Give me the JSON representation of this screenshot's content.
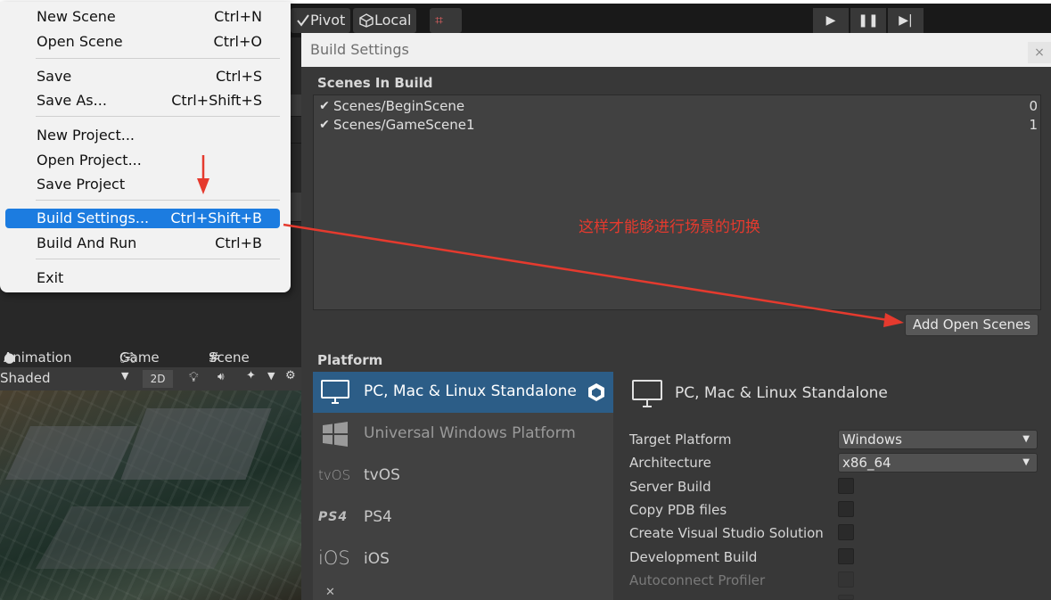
{
  "toolbar": {
    "pivot_label": "Pivot",
    "local_label": "Local",
    "play_icons": [
      "play-icon",
      "pause-icon",
      "step-icon"
    ]
  },
  "menu": {
    "items": [
      {
        "label": "New Scene",
        "shortcut": "Ctrl+N"
      },
      {
        "label": "Open Scene",
        "shortcut": "Ctrl+O"
      },
      {
        "label": "Save",
        "shortcut": "Ctrl+S"
      },
      {
        "label": "Save As...",
        "shortcut": "Ctrl+Shift+S"
      },
      {
        "label": "New Project...",
        "shortcut": ""
      },
      {
        "label": "Open Project...",
        "shortcut": ""
      },
      {
        "label": "Save Project",
        "shortcut": ""
      },
      {
        "label": "Build Settings...",
        "shortcut": "Ctrl+Shift+B"
      },
      {
        "label": "Build And Run",
        "shortcut": "Ctrl+B"
      },
      {
        "label": "Exit",
        "shortcut": ""
      }
    ],
    "active_item": "Build Settings..."
  },
  "panel_tabs": {
    "animation": "Animation",
    "game": "Game",
    "scene": "Scene",
    "shading_mode": "Shaded",
    "mode_2d": "2D"
  },
  "build_settings": {
    "title": "Build Settings",
    "close_label": "×",
    "scenes_header": "Scenes In Build",
    "scenes": [
      {
        "name": "Scenes/BeginScene",
        "index": "0",
        "checked": true
      },
      {
        "name": "Scenes/GameScene1",
        "index": "1",
        "checked": true
      }
    ],
    "check_mark": "✔",
    "add_open_scenes": "Add Open Scenes",
    "platform_header": "Platform",
    "platforms": [
      {
        "label": "PC, Mac & Linux Standalone",
        "icon": "monitor-icon"
      },
      {
        "label": "Universal Windows Platform",
        "icon": "windows-icon"
      },
      {
        "label": "tvOS",
        "icon": "tvos-icon",
        "icon_text": "tvOS"
      },
      {
        "label": "PS4",
        "icon": "ps4-icon",
        "icon_text": "PS4"
      },
      {
        "label": "iOS",
        "icon": "ios-icon",
        "icon_text": "iOS"
      }
    ],
    "selected_platform": "PC, Mac & Linux Standalone",
    "detail_title": "PC, Mac & Linux Standalone",
    "options": {
      "target_platform": {
        "label": "Target Platform",
        "value": "Windows"
      },
      "architecture": {
        "label": "Architecture",
        "value": "x86_64"
      },
      "server_build": "Server Build",
      "copy_pdb": "Copy PDB files",
      "create_vs": "Create Visual Studio Solution",
      "development_build": "Development Build",
      "autoconnect_profiler": "Autoconnect Profiler"
    }
  },
  "annotation": {
    "text": "这样才能够进行场景的切换",
    "color": "#e53a2e"
  },
  "colors": {
    "menu_highlight": "#1c7ce0",
    "platform_selected": "#2c5d87"
  }
}
